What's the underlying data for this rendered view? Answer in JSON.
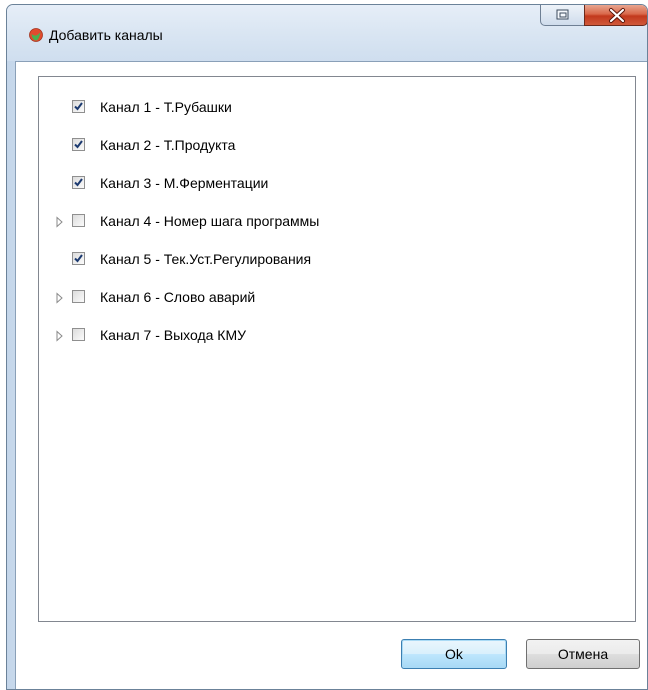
{
  "window": {
    "title": "Добавить каналы"
  },
  "channels": [
    {
      "label": "Канал 1 - Т.Рубашки",
      "checked": true,
      "expandable": false
    },
    {
      "label": "Канал 2 - Т.Продукта",
      "checked": true,
      "expandable": false
    },
    {
      "label": "Канал 3 - М.Ферментации",
      "checked": true,
      "expandable": false
    },
    {
      "label": "Канал 4 - Номер шага программы",
      "checked": false,
      "expandable": true
    },
    {
      "label": "Канал 5 - Тек.Уст.Регулирования",
      "checked": true,
      "expandable": false
    },
    {
      "label": "Канал 6 - Слово аварий",
      "checked": false,
      "expandable": true
    },
    {
      "label": "Канал 7 - Выхода КМУ",
      "checked": false,
      "expandable": true
    }
  ],
  "buttons": {
    "ok_label": "Ok",
    "cancel_label": "Отмена"
  },
  "colors": {
    "title_bar": "#d9e5f2",
    "close_button": "#c2391d",
    "check_mark": "#1c3a70",
    "ok_button_border": "#3c7fb1"
  },
  "icons": {
    "app": "app-logo-icon",
    "restore": "restore-icon",
    "close": "close-x-icon",
    "expander": "expand-triangle-icon",
    "check": "checkmark-icon"
  }
}
